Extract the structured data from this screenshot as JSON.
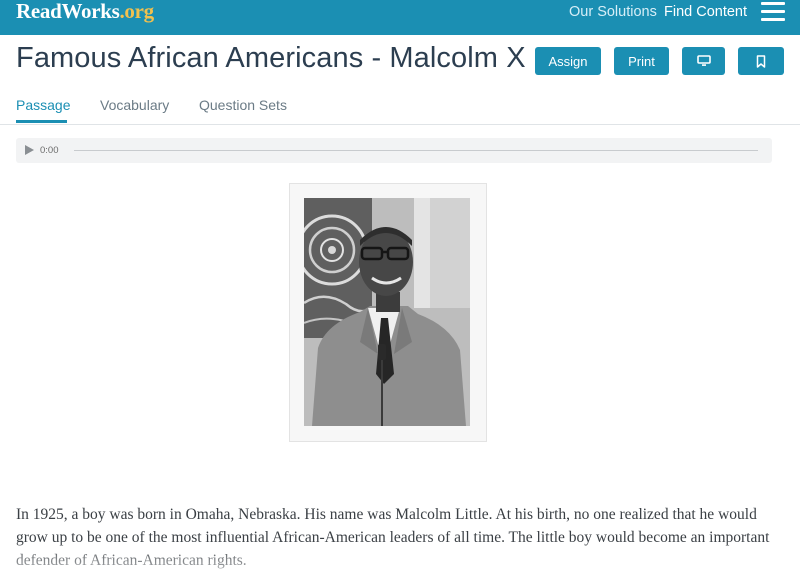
{
  "header": {
    "logo_main": "ReadWorks",
    "logo_suffix": ".org",
    "nav": {
      "solutions": "Our Solutions",
      "find_content": "Find Content"
    }
  },
  "title": "Famous African Americans - Malcolm X",
  "actions": {
    "assign": "Assign",
    "print": "Print"
  },
  "tabs": [
    {
      "label": "Passage",
      "active": true
    },
    {
      "label": "Vocabulary",
      "active": false
    },
    {
      "label": "Question Sets",
      "active": false
    }
  ],
  "audio": {
    "time": "0:00"
  },
  "passage": "In 1925, a boy was born in Omaha, Nebraska. His name was Malcolm Little. At his birth, no one realized that he would grow up to be one of the most influential African-American leaders of all time. The little boy would become an important defender of African-American rights.",
  "colors": {
    "brand": "#1b8fb3",
    "title": "#2c3e50",
    "logo_dot": "#f2c14e"
  }
}
